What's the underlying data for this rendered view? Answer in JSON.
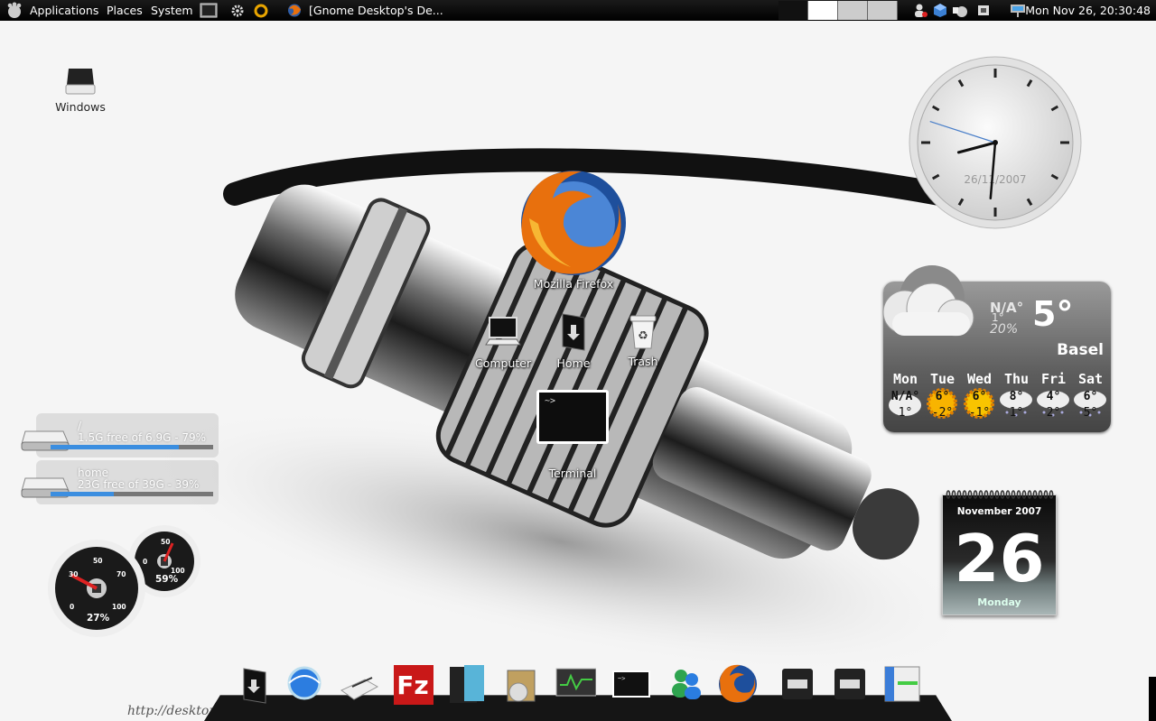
{
  "top_panel": {
    "menus": [
      "Applications",
      "Places",
      "System"
    ],
    "window_title": "[Gnome Desktop's De...",
    "clock": "Mon Nov 26, 20:30:48",
    "icons": [
      "gnome-foot-icon",
      "terminal-launcher-icon",
      "settings-gears-icon",
      "firefox-icon",
      "network-user-icon",
      "cube-icon",
      "volume-icon",
      "cpu-chip-icon",
      "network-connection-icon"
    ]
  },
  "desktop": {
    "icons": [
      {
        "label": "Windows",
        "icon": "drive-icon"
      },
      {
        "label": "Mozilla Firefox",
        "icon": "firefox-icon"
      },
      {
        "label": "Computer",
        "icon": "computer-icon"
      },
      {
        "label": "Home",
        "icon": "home-folder-icon"
      },
      {
        "label": "Trash",
        "icon": "trash-icon"
      },
      {
        "label": "Terminal",
        "icon": "terminal-icon"
      }
    ]
  },
  "clock_widget": {
    "date": "26/11/2007",
    "time": {
      "hours": 20,
      "minutes": 30,
      "seconds": 48
    }
  },
  "weather": {
    "current_na": "N/A°",
    "current_low": "1°",
    "humidity": "20%",
    "temperature": "5°",
    "city": "Basel",
    "forecast": [
      {
        "day": "Mon",
        "high": "N/A°",
        "low": "1°",
        "icon": "cloud-icon"
      },
      {
        "day": "Tue",
        "high": "6°",
        "low": "-2°",
        "icon": "sun-icon"
      },
      {
        "day": "Wed",
        "high": "6°",
        "low": "-1°",
        "icon": "sun-icon"
      },
      {
        "day": "Thu",
        "high": "8°",
        "low": "1°",
        "icon": "snow-cloud-icon"
      },
      {
        "day": "Fri",
        "high": "4°",
        "low": "2°",
        "icon": "snow-cloud-icon"
      },
      {
        "day": "Sat",
        "high": "6°",
        "low": "5°",
        "icon": "snow-cloud-icon"
      }
    ]
  },
  "calendar": {
    "month": "November 2007",
    "day": "26",
    "weekday": "Monday"
  },
  "disks": [
    {
      "name": "/",
      "info": "1.5G free of 6.9G - 79%",
      "used_fraction": 0.79
    },
    {
      "name": "home",
      "info": "23G free of 39G - 39%",
      "used_fraction": 0.39
    }
  ],
  "gauges": {
    "cpu": {
      "percent": "27%",
      "value": 27,
      "ticks": [
        "0",
        "30",
        "50",
        "70",
        "100"
      ]
    },
    "memory": {
      "percent": "59%",
      "value": 59,
      "ticks": [
        "0",
        "50",
        "100"
      ]
    }
  },
  "dock": {
    "items": [
      "home-folder-icon",
      "browser-globe-icon",
      "editor-icon",
      "filezilla-icon",
      "text-editor-icon",
      "package-installer-icon",
      "system-monitor-icon",
      "terminal-icon",
      "messenger-icon",
      "firefox-icon",
      "disk-window-icon",
      "disk-window-icon",
      "window-icon"
    ]
  },
  "watermark": "http://desktop.",
  "colors": {
    "panel": "#000000",
    "bar_fill": "#3b8ee0",
    "weather_bg": "#6e6e6e"
  }
}
